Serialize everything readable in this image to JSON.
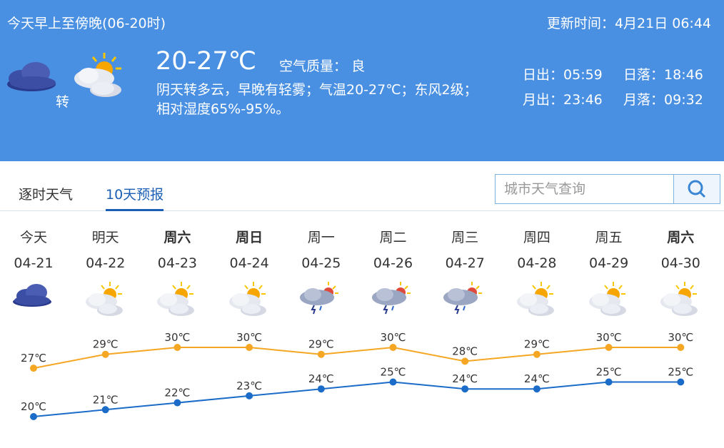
{
  "header": {
    "period": "今天早上至傍晚(06-20时)",
    "update_label": "更新时间：",
    "update_time": "4月21日 06:44",
    "temp_range": "20-27℃",
    "air_quality_label": "空气质量：",
    "air_quality": "良",
    "transition": "转",
    "description_line1": "阴天转多云，早晚有轻雾；气温20-27℃；东风2级；",
    "description_line2": "相对湿度65%-95%。",
    "sunrise_label": "日出：",
    "sunrise": "05:59",
    "sunset_label": "日落：",
    "sunset": "18:46",
    "moonrise_label": "月出：",
    "moonrise": "23:46",
    "moonset_label": "月落：",
    "moonset": "09:32",
    "icon_from": "overcast-cloud-icon",
    "icon_to": "partly-cloudy-icon"
  },
  "tabs": [
    {
      "label": "逐时天气",
      "active": false
    },
    {
      "label": "10天预报",
      "active": true
    }
  ],
  "search": {
    "placeholder": "城市天气查询",
    "icon": "search-icon"
  },
  "forecast": [
    {
      "day": "今天",
      "date": "04-21",
      "bold": false,
      "icon": "overcast",
      "high": 27,
      "low": 20
    },
    {
      "day": "明天",
      "date": "04-22",
      "bold": false,
      "icon": "partly-cloudy",
      "high": 29,
      "low": 21
    },
    {
      "day": "周六",
      "date": "04-23",
      "bold": true,
      "icon": "partly-cloudy",
      "high": 30,
      "low": 22
    },
    {
      "day": "周日",
      "date": "04-24",
      "bold": true,
      "icon": "partly-cloudy",
      "high": 30,
      "low": 23
    },
    {
      "day": "周一",
      "date": "04-25",
      "bold": false,
      "icon": "thunder-shower",
      "high": 29,
      "low": 24
    },
    {
      "day": "周二",
      "date": "04-26",
      "bold": false,
      "icon": "thunder-shower",
      "high": 30,
      "low": 25
    },
    {
      "day": "周三",
      "date": "04-27",
      "bold": false,
      "icon": "thunder-shower",
      "high": 28,
      "low": 24
    },
    {
      "day": "周四",
      "date": "04-28",
      "bold": false,
      "icon": "partly-cloudy",
      "high": 29,
      "low": 24
    },
    {
      "day": "周五",
      "date": "04-29",
      "bold": false,
      "icon": "partly-cloudy",
      "high": 30,
      "low": 25
    },
    {
      "day": "周六",
      "date": "04-30",
      "bold": true,
      "icon": "partly-cloudy",
      "high": 30,
      "low": 25
    }
  ],
  "temp_unit": "℃",
  "colors": {
    "banner": "#4a90e2",
    "high_line": "#f5a623",
    "low_line": "#1b6cc8",
    "tab_active": "#1b5fb5"
  },
  "chart_data": {
    "type": "line",
    "categories": [
      "04-21",
      "04-22",
      "04-23",
      "04-24",
      "04-25",
      "04-26",
      "04-27",
      "04-28",
      "04-29",
      "04-30"
    ],
    "series": [
      {
        "values": [
          27,
          29,
          30,
          30,
          29,
          30,
          28,
          29,
          30,
          30
        ]
      },
      {
        "values": [
          20,
          21,
          22,
          23,
          24,
          25,
          24,
          24,
          25,
          25
        ]
      }
    ],
    "unit": "℃"
  }
}
